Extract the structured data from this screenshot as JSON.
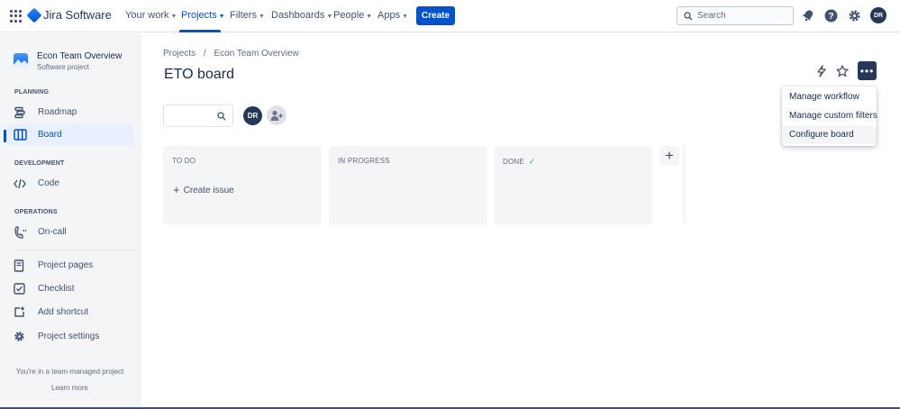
{
  "topnav": {
    "product": "Jira Software",
    "items": [
      {
        "label": "Your work",
        "chevron": true
      },
      {
        "label": "Projects",
        "chevron": true,
        "active": true
      },
      {
        "label": "Filters",
        "chevron": true
      },
      {
        "label": "Dashboards",
        "chevron": true
      },
      {
        "label": "People",
        "chevron": true
      },
      {
        "label": "Apps",
        "chevron": true
      }
    ],
    "create_label": "Create",
    "search_placeholder": "Search",
    "icons": [
      "notifications-icon",
      "help-icon",
      "settings-icon"
    ],
    "avatar_initials": "DR"
  },
  "sidebar": {
    "project_name": "Econ Team Overview",
    "project_type": "Software project",
    "sections": [
      {
        "title": "PLANNING",
        "items": [
          {
            "label": "Roadmap",
            "icon": "roadmap-icon"
          },
          {
            "label": "Board",
            "icon": "board-icon",
            "active": true
          }
        ]
      },
      {
        "title": "DEVELOPMENT",
        "items": [
          {
            "label": "Code",
            "icon": "code-icon"
          }
        ]
      },
      {
        "title": "OPERATIONS",
        "items": [
          {
            "label": "On-call",
            "icon": "on-call-icon"
          }
        ]
      }
    ],
    "extra_items": [
      {
        "label": "Project pages",
        "icon": "pages-icon"
      },
      {
        "label": "Checklist",
        "icon": "checklist-icon"
      },
      {
        "label": "Add shortcut",
        "icon": "add-shortcut-icon"
      },
      {
        "label": "Project settings",
        "icon": "settings-icon"
      }
    ],
    "footer_text": "You're in a team-managed project",
    "footer_link": "Learn more"
  },
  "main": {
    "breadcrumb": [
      "Projects",
      "Econ Team Overview"
    ],
    "title": "ETO board",
    "avatar_initials": "DR",
    "columns": [
      {
        "title": "TO DO",
        "create_label": "Create issue"
      },
      {
        "title": "IN PROGRESS"
      },
      {
        "title": "DONE",
        "done_check": true
      }
    ],
    "menu": {
      "items": [
        "Manage workflow",
        "Manage custom filters",
        "Configure board"
      ],
      "highlighted": "Configure board"
    }
  },
  "colors": {
    "accent": "#0052cc",
    "dark": "#253858",
    "sidebar_bg": "#f4f5f7",
    "done_check": "#36b37e"
  }
}
